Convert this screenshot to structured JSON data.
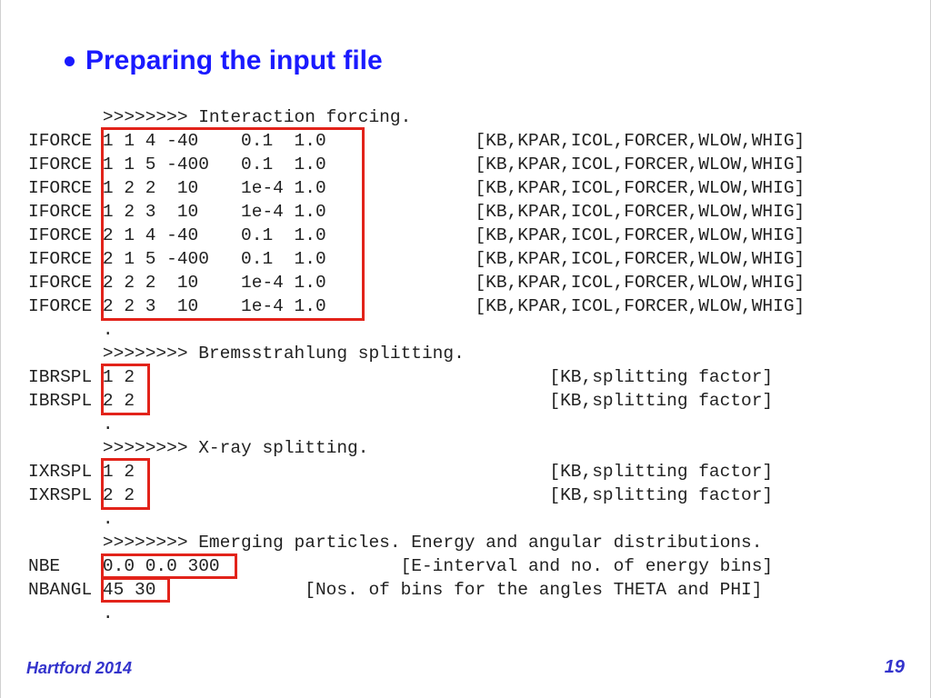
{
  "title": "Preparing the input file",
  "footer": {
    "venue": "Hartford 2014",
    "page": "19"
  },
  "sections": {
    "s0": {
      "header": "       >>>>>>>> Interaction forcing."
    },
    "s1": {
      "header": "       >>>>>>>> Bremsstrahlung splitting."
    },
    "s2": {
      "header": "       >>>>>>>> X-ray splitting."
    },
    "s3": {
      "header": "       >>>>>>>> Emerging particles. Energy and angular distributions."
    }
  },
  "iforce": [
    "IFORCE 1 1 4 -40    0.1  1.0              [KB,KPAR,ICOL,FORCER,WLOW,WHIG]",
    "IFORCE 1 1 5 -400   0.1  1.0              [KB,KPAR,ICOL,FORCER,WLOW,WHIG]",
    "IFORCE 1 2 2  10    1e-4 1.0              [KB,KPAR,ICOL,FORCER,WLOW,WHIG]",
    "IFORCE 1 2 3  10    1e-4 1.0              [KB,KPAR,ICOL,FORCER,WLOW,WHIG]",
    "IFORCE 2 1 4 -40    0.1  1.0              [KB,KPAR,ICOL,FORCER,WLOW,WHIG]",
    "IFORCE 2 1 5 -400   0.1  1.0              [KB,KPAR,ICOL,FORCER,WLOW,WHIG]",
    "IFORCE 2 2 2  10    1e-4 1.0              [KB,KPAR,ICOL,FORCER,WLOW,WHIG]",
    "IFORCE 2 2 3  10    1e-4 1.0              [KB,KPAR,ICOL,FORCER,WLOW,WHIG]"
  ],
  "ibrspl": [
    "IBRSPL 1 2                                       [KB,splitting factor]",
    "IBRSPL 2 2                                       [KB,splitting factor]"
  ],
  "ixrspl": [
    "IXRSPL 1 2                                       [KB,splitting factor]",
    "IXRSPL 2 2                                       [KB,splitting factor]"
  ],
  "nbe": "NBE    0.0 0.0 300                 [E-interval and no. of energy bins]",
  "nbangl": "NBANGL 45 30              [Nos. of bins for the angles THETA and PHI]",
  "dot": "       ."
}
